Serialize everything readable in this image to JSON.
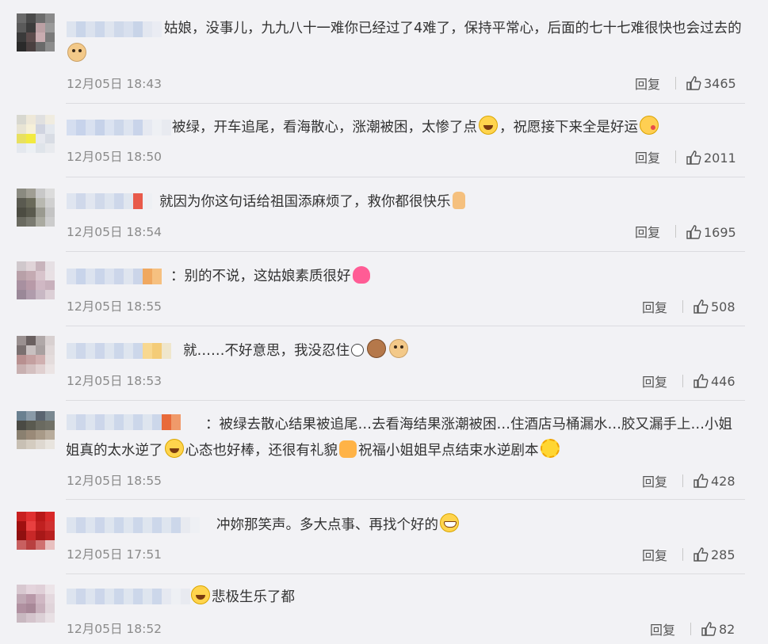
{
  "comments": [
    {
      "text": "姑娘，没事儿，九九八十一难你已经过了4难了，保持平常心，后面的七十七难很快也会过去的",
      "emojis": [
        "doge"
      ],
      "time": "12月05日 18:43",
      "reply_label": "回复",
      "likes": "3465"
    },
    {
      "text": "被绿，开车追尾，看海散心，涨潮被困，太惨了点",
      "text2": "，祝愿接下来全是好运",
      "emojis": [
        "laugh",
        "kiss"
      ],
      "time": "12月05日 18:50",
      "reply_label": "回复",
      "likes": "2011"
    },
    {
      "text": "就因为你这句话给祖国添麻烦了，救你都很快乐",
      "emojis": [
        "thumbs-up"
      ],
      "time": "12月05日 18:54",
      "reply_label": "回复",
      "likes": "1695"
    },
    {
      "text": "：别的不说，这姑娘素质很好",
      "emojis": [
        "heart"
      ],
      "time": "12月05日 18:55",
      "reply_label": "回复",
      "likes": "508"
    },
    {
      "text": "就……不好意思，我没忍住",
      "emojis": [
        "face",
        "mouse",
        "doge"
      ],
      "time": "12月05日 18:53",
      "reply_label": "回复",
      "likes": "446"
    },
    {
      "text": "：被绿去散心结果被追尾…去看海结果涨潮被困…住酒店马桶漏水…胶又漏手上…小姐姐真的太水逆了",
      "text2": "心态也好棒，还很有礼貌",
      "text3": "祝福小姐姐早点结束水逆剧本",
      "emojis": [
        "laugh",
        "star",
        "sun"
      ],
      "time": "12月05日 18:55",
      "reply_label": "回复",
      "likes": "428"
    },
    {
      "text": "冲妳那笑声。多大点事、再找个好的",
      "emojis": [
        "grin"
      ],
      "time": "12月05日 17:51",
      "reply_label": "回复",
      "likes": "285"
    },
    {
      "text": "悲极生乐了都",
      "emojis": [
        "laugh"
      ],
      "time": "12月05日 18:52",
      "reply_label": "回复",
      "likes": "82"
    }
  ],
  "colors": {
    "background": "#f2f2f5",
    "text": "#333333",
    "meta": "#8a8a8a",
    "divider": "#dcdce0"
  },
  "icons": {
    "like": "thumbs-up-icon"
  }
}
